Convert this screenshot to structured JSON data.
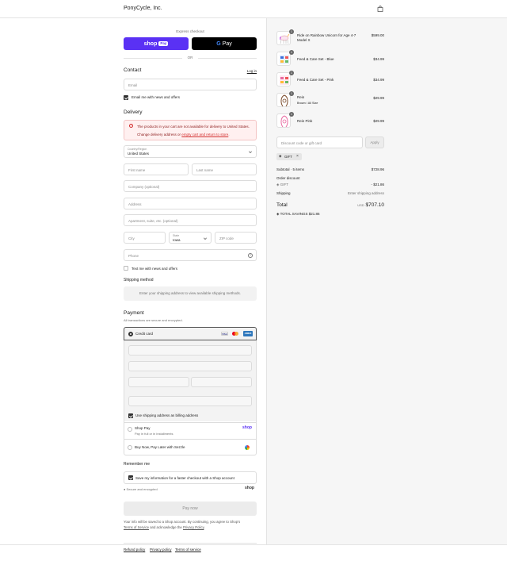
{
  "header": {
    "brand": "PonyCycle, Inc.",
    "cart_icon": "bag-icon"
  },
  "express": {
    "label": "Express checkout",
    "shop_pay_label": "shop",
    "shop_pay_badge": "Pay",
    "gpay_g": "G",
    "gpay_label": "Pay",
    "or_label": "OR"
  },
  "contact": {
    "heading": "Contact",
    "login_link": "Log in",
    "email_placeholder": "Email",
    "news_label": "Email me with news and offers"
  },
  "delivery": {
    "heading": "Delivery",
    "error_line1": "The products in your cart are not available for delivery to United States.",
    "error_line2_prefix": "Change delivery address or ",
    "error_link": "empty cart and return to store",
    "error_line2_suffix": ".",
    "country_label": "Country/Region",
    "country_value": "United States",
    "first_name": "First name",
    "last_name": "Last name",
    "company": "Company (optional)",
    "address": "Address",
    "apartment": "Apartment, suite, etc. (optional)",
    "city": "City",
    "state_label": "State",
    "state_value": "Iowa",
    "zip": "ZIP code",
    "phone": "Phone",
    "text_news": "Text me with news and offers"
  },
  "shipping": {
    "heading": "Shipping method",
    "message": "Enter your shipping address to view available shipping methods."
  },
  "payment": {
    "heading": "Payment",
    "subtext": "All transactions are secure and encrypted.",
    "credit_card": "Credit card",
    "visa": "VISA",
    "amex": "AMEX",
    "billing_same": "Use shipping address as billing address",
    "shop_pay": "Shop Pay",
    "shop_pay_sub": "Pay in full or in installments",
    "shop_logo": "shop",
    "sezzle": "Buy Now, Pay Later with Sezzle"
  },
  "remember": {
    "heading": "Remember me",
    "save_label": "Save my information for a faster checkout with a Shop account",
    "secure": "Secure and encrypted",
    "shop_logo": "shop"
  },
  "pay_now": "Pay now",
  "legal": {
    "line1": "Your info will be saved to a Shop account. By continuing, you agree to Shop's",
    "tos": "Terms of Service",
    "mid": " and acknowledge the ",
    "privacy": "Privacy Policy",
    "end": "."
  },
  "footer_links": [
    "Refund policy",
    "Privacy policy",
    "Terms of service"
  ],
  "order": {
    "items": [
      {
        "name": "Ride on Rainbow Unicorn for Age 4-7 Model X",
        "variant": "",
        "price": "$599.00",
        "qty": "1"
      },
      {
        "name": "Feed & Care Set - Blue",
        "variant": "",
        "price": "$34.99",
        "qty": "1"
      },
      {
        "name": "Feed & Care Set - Pink",
        "variant": "",
        "price": "$34.99",
        "qty": "1"
      },
      {
        "name": "Rein",
        "variant": "Brown / All Size",
        "price": "$29.99",
        "qty": "1"
      },
      {
        "name": "Rein Pink",
        "variant": "",
        "price": "$29.99",
        "qty": "1"
      }
    ],
    "discount_placeholder": "Discount code or gift card",
    "apply": "Apply",
    "tag": "GIFT",
    "subtotal_label": "Subtotal · 5 items",
    "subtotal_value": "$728.96",
    "order_discount_label": "Order discount",
    "discount_code": "GIFT",
    "discount_value": "- $21.86",
    "shipping_label": "Shipping",
    "shipping_value": "Enter shipping address",
    "total_label": "Total",
    "currency": "USD",
    "total_value": "$707.10",
    "savings_label": "TOTAL SAVINGS",
    "savings_value": "$21.86"
  }
}
